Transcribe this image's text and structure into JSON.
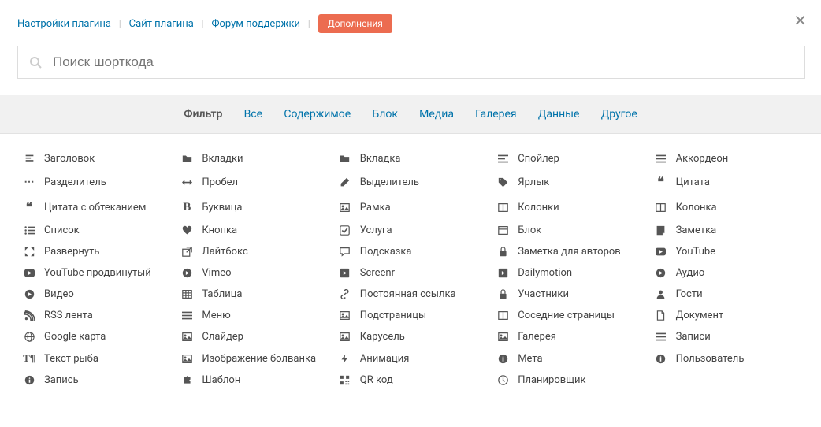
{
  "nav": {
    "settings": "Настройки плагина",
    "site": "Сайт плагина",
    "forum": "Форум поддержки",
    "addons": "Дополнения"
  },
  "search": {
    "placeholder": "Поиск шорткода"
  },
  "filter": {
    "label": "Фильтр",
    "all": "Все",
    "content": "Содержимое",
    "block": "Блок",
    "media": "Медиа",
    "gallery": "Галерея",
    "data": "Данные",
    "other": "Другое"
  },
  "items": [
    {
      "icon": "header",
      "label": "Заголовок"
    },
    {
      "icon": "folder",
      "label": "Вкладки"
    },
    {
      "icon": "folder",
      "label": "Вкладка"
    },
    {
      "icon": "bars-stagger",
      "label": "Спойлер"
    },
    {
      "icon": "list",
      "label": "Аккордеон"
    },
    {
      "icon": "ellipsis",
      "label": "Разделитель"
    },
    {
      "icon": "arrows-h",
      "label": "Пробел"
    },
    {
      "icon": "pencil",
      "label": "Выделитель"
    },
    {
      "icon": "tag",
      "label": "Ярлык"
    },
    {
      "icon": "quote",
      "label": "Цитата"
    },
    {
      "icon": "quote",
      "label": "Цитата с обтеканием"
    },
    {
      "icon": "bold",
      "label": "Буквица"
    },
    {
      "icon": "image",
      "label": "Рамка"
    },
    {
      "icon": "columns",
      "label": "Колонки"
    },
    {
      "icon": "columns",
      "label": "Колонка"
    },
    {
      "icon": "list-ul",
      "label": "Список"
    },
    {
      "icon": "heart",
      "label": "Кнопка"
    },
    {
      "icon": "check",
      "label": "Услуга"
    },
    {
      "icon": "block",
      "label": "Блок"
    },
    {
      "icon": "note",
      "label": "Заметка"
    },
    {
      "icon": "expand",
      "label": "Развернуть"
    },
    {
      "icon": "external",
      "label": "Лайтбокс"
    },
    {
      "icon": "comment",
      "label": "Подсказка"
    },
    {
      "icon": "lock",
      "label": "Заметка для авторов"
    },
    {
      "icon": "youtube",
      "label": "YouTube"
    },
    {
      "icon": "youtube",
      "label": "YouTube продвинутый"
    },
    {
      "icon": "play-circle",
      "label": "Vimeo"
    },
    {
      "icon": "play-square",
      "label": "Screenr"
    },
    {
      "icon": "play-square",
      "label": "Dailymotion"
    },
    {
      "icon": "play-circle",
      "label": "Аудио"
    },
    {
      "icon": "play-circle",
      "label": "Видео"
    },
    {
      "icon": "table",
      "label": "Таблица"
    },
    {
      "icon": "link",
      "label": "Постоянная ссылка"
    },
    {
      "icon": "lock",
      "label": "Участники"
    },
    {
      "icon": "user",
      "label": "Гости"
    },
    {
      "icon": "rss",
      "label": "RSS лента"
    },
    {
      "icon": "bars",
      "label": "Меню"
    },
    {
      "icon": "image",
      "label": "Подстраницы"
    },
    {
      "icon": "columns",
      "label": "Соседние страницы"
    },
    {
      "icon": "document",
      "label": "Документ"
    },
    {
      "icon": "globe",
      "label": "Google карта"
    },
    {
      "icon": "image",
      "label": "Слайдер"
    },
    {
      "icon": "image",
      "label": "Карусель"
    },
    {
      "icon": "image",
      "label": "Галерея"
    },
    {
      "icon": "list",
      "label": "Записи"
    },
    {
      "icon": "text",
      "label": "Текст рыба"
    },
    {
      "icon": "image",
      "label": "Изображение болванка"
    },
    {
      "icon": "bolt",
      "label": "Анимация"
    },
    {
      "icon": "info",
      "label": "Мета"
    },
    {
      "icon": "info",
      "label": "Пользователь"
    },
    {
      "icon": "info",
      "label": "Запись"
    },
    {
      "icon": "puzzle",
      "label": "Шаблон"
    },
    {
      "icon": "qr",
      "label": "QR код"
    },
    {
      "icon": "clock",
      "label": "Планировщик"
    }
  ]
}
